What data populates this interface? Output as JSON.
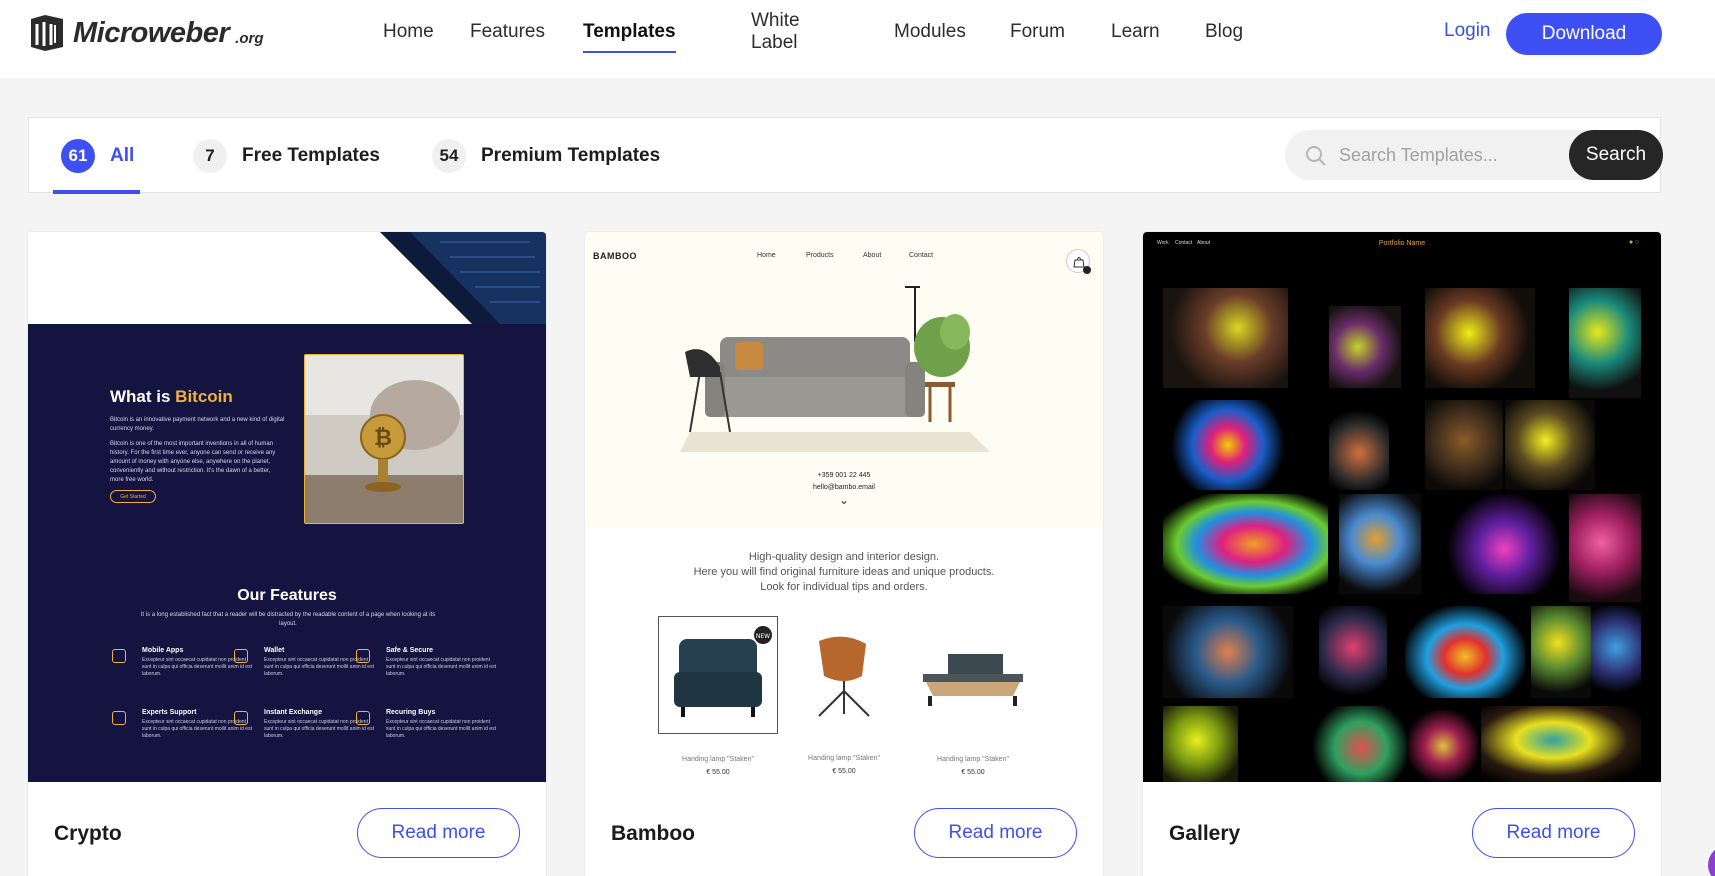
{
  "header": {
    "logo_word": "Microweber",
    "logo_tld": ".org",
    "nav": [
      "Home",
      "Features",
      "Templates",
      "White Label",
      "Modules",
      "Forum",
      "Learn",
      "Blog"
    ],
    "active_nav": "Templates",
    "login_label": "Login",
    "download_label": "Download"
  },
  "filters": {
    "tabs": [
      {
        "count": "61",
        "label": "All",
        "active": true
      },
      {
        "count": "7",
        "label": "Free Templates",
        "active": false
      },
      {
        "count": "54",
        "label": "Premium Templates",
        "active": false
      }
    ],
    "search_placeholder": "Search Templates...",
    "search_button": "Search"
  },
  "cards": [
    {
      "title": "Crypto",
      "button": "Read more",
      "preview": {
        "heading_pre": "What is ",
        "heading_accent": "Bitcoin",
        "intro": "Bitcoin is an innovative payment network and a new kind of digital currency money.",
        "body": "Bitcoin is one of the most important inventions in all of human history. For the first time ever, anyone can send or receive any amount of money with anyone else, anywhere on the planet, conveniently and without restriction. It's the dawn of a better, more free world.",
        "cta": "Get Started",
        "features_title": "Our Features",
        "features_sub": "It is a long established fact that a reader will be distracted by the readable content of a page when looking at its layout.",
        "features": [
          {
            "title": "Mobile Apps",
            "desc": "Excepteur sint occaecat cupidatat non proident sunt in culpa qui officia deserunt mollit anim id est laborum."
          },
          {
            "title": "Wallet",
            "desc": "Excepteur sint occaecat cupidatat non proident sunt in culpa qui officia deserunt mollit anim id est laborum."
          },
          {
            "title": "Safe & Secure",
            "desc": "Excepteur sint occaecat cupidatat non proident sunt in culpa qui officia deserunt mollit anim id est laborum."
          },
          {
            "title": "Experts Support",
            "desc": "Excepteur sint occaecat cupidatat non proident sunt in culpa qui officia deserunt mollit anim id est laborum."
          },
          {
            "title": "Instant Exchange",
            "desc": "Excepteur sint occaecat cupidatat non proident sunt in culpa qui officia deserunt mollit anim id est laborum."
          },
          {
            "title": "Recuring Buys",
            "desc": "Excepteur sint occaecat cupidatat non proident sunt in culpa qui officia deserunt mollit anim id est laborum."
          }
        ]
      }
    },
    {
      "title": "Bamboo",
      "button": "Read more",
      "preview": {
        "logo": "BAMBOO",
        "nav": [
          "Home",
          "Products",
          "About",
          "Contact"
        ],
        "phone": "+359 001 22 445",
        "email": "hello@bambo.email",
        "desc": [
          "High-quality design and interior design.",
          "Here you will find original furniture ideas and unique products.",
          "Look for individual tips and orders."
        ],
        "badge": "NEW",
        "products": [
          {
            "name": "Handing lamp \"Staken\"",
            "price": "€ 55.00"
          },
          {
            "name": "Handing lamp \"Staken\"",
            "price": "€ 55.00"
          },
          {
            "name": "Handing lamp \"Staken\"",
            "price": "€ 55.00"
          }
        ]
      }
    },
    {
      "title": "Gallery",
      "button": "Read more",
      "preview": {
        "site_title": "Portfolio Name",
        "nav": [
          "Work",
          "Contact",
          "About"
        ]
      }
    }
  ],
  "colors": {
    "accent": "#3e4ff3",
    "crypto_bg": "#15133f",
    "crypto_gold": "#f2b233",
    "bamboo_bg": "#fdfdf3",
    "gallery_bg": "#000000"
  }
}
